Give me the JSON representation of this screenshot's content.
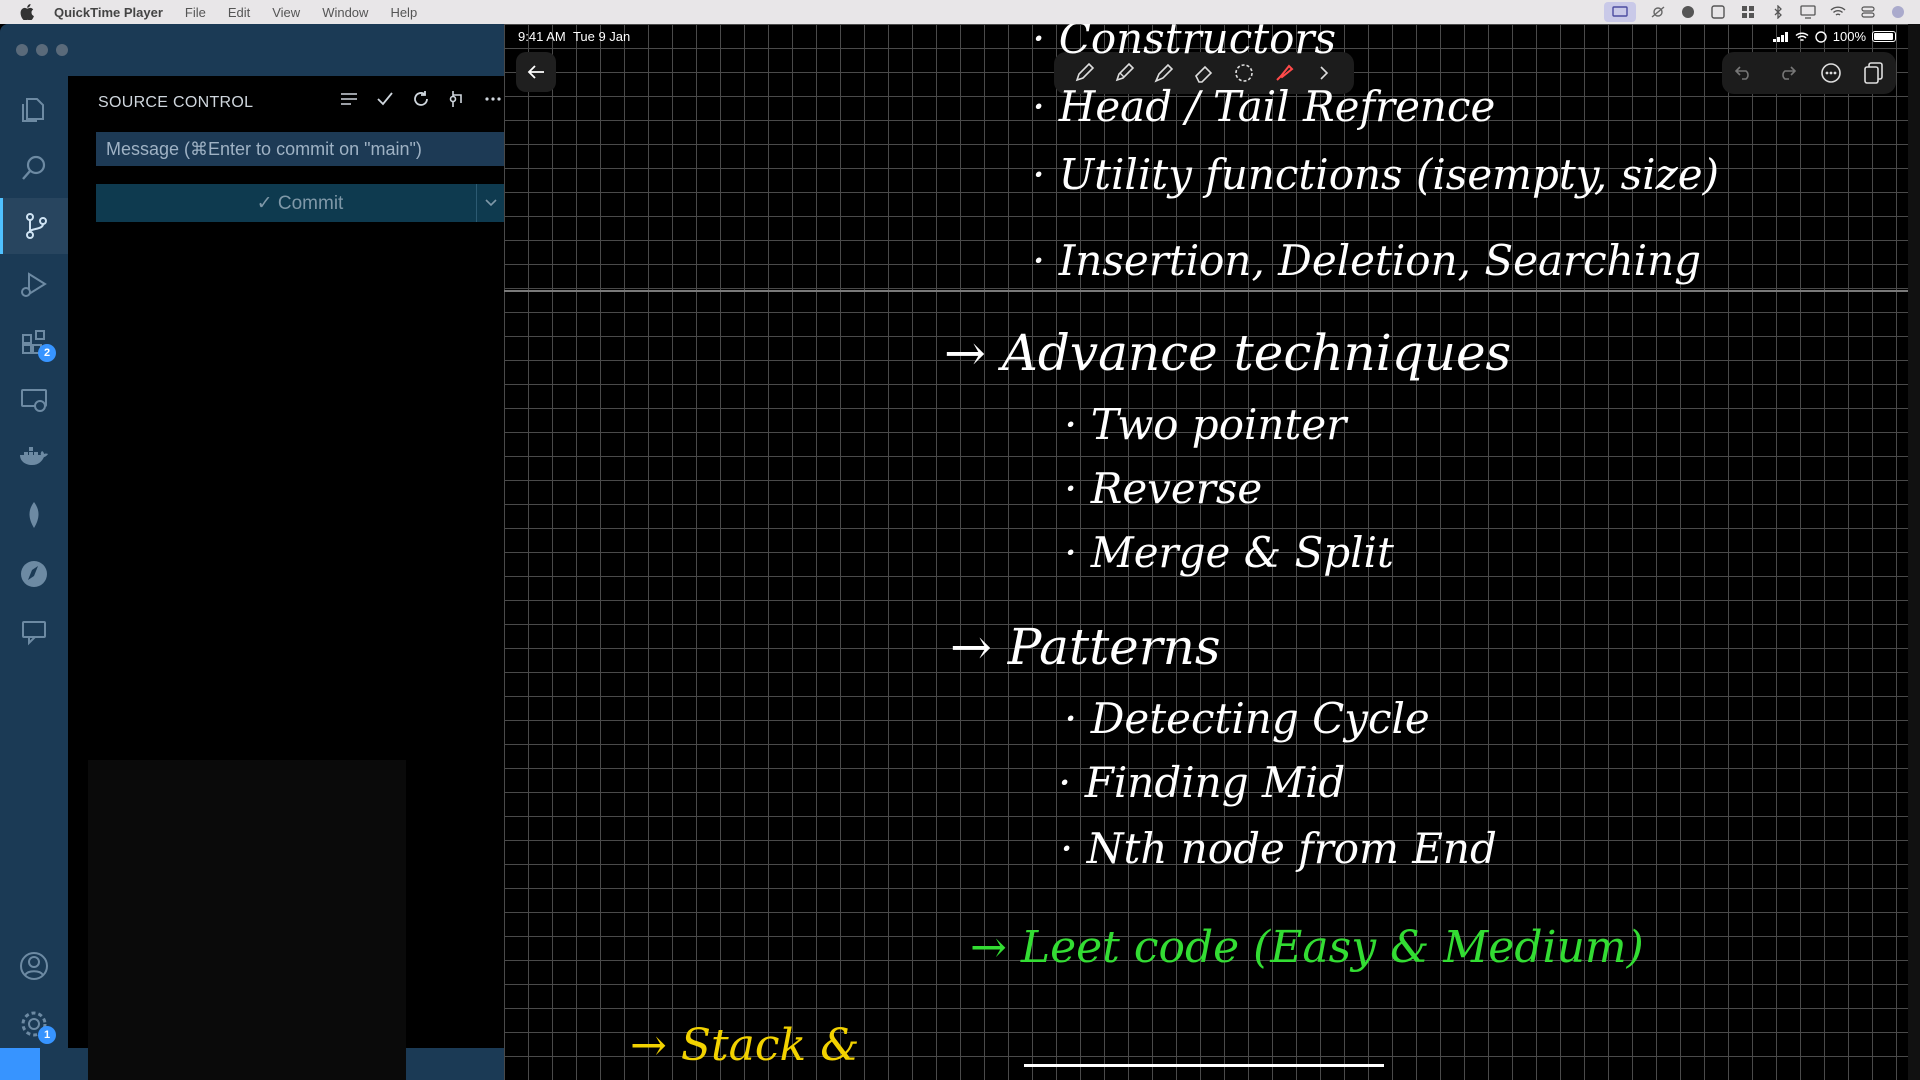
{
  "menubar": {
    "app_name": "QuickTime Player",
    "menus": [
      "File",
      "Edit",
      "View",
      "Window",
      "Help"
    ]
  },
  "vscode": {
    "panel_title": "SOURCE CONTROL",
    "message_placeholder": "Message (⌘Enter to commit on \"main\")",
    "commit_label": "✓ Commit",
    "extensions_badge": "2",
    "settings_badge": "1"
  },
  "ipad": {
    "time": "9:41 AM",
    "date": "Tue 9 Jan",
    "battery": "100%"
  },
  "notes": {
    "line_top_partial": "· Constructors",
    "line_head_tail": "· Head / Tail Refrence",
    "line_utility": "· Utility functions (isempty, size)",
    "line_insertion": "· Insertion, Deletion, Searching",
    "advance_heading": "→ Advance techniques",
    "advance_items": [
      "· Two pointer",
      "· Reverse",
      "· Merge & Split"
    ],
    "patterns_heading": "→ Patterns",
    "patterns_items": [
      "· Detecting Cycle",
      "· Finding Mid",
      "· Nth node from End"
    ],
    "leetcode": "→ Leet code (Easy & Medium)",
    "stack_partial": "→ Stack &"
  },
  "colors": {
    "vscode_blue": "#1b3a55",
    "accent": "#3794ff",
    "note_white": "#ffffff",
    "note_green": "#33dd33",
    "note_yellow": "#f2d200"
  }
}
